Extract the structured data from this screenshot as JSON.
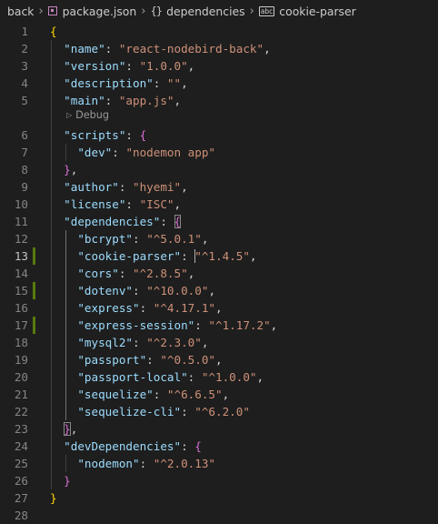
{
  "breadcrumb": {
    "folder": "back",
    "file": "package.json",
    "section": "dependencies",
    "symbol": "cookie-parser",
    "separator": "›"
  },
  "codelens": "Debug",
  "active_line": 13,
  "lines": [
    {
      "n": "1",
      "tokens": [
        {
          "t": "{",
          "c": "b1"
        }
      ]
    },
    {
      "n": "2",
      "tokens": [
        {
          "t": "  "
        },
        {
          "t": "\"name\"",
          "c": "k"
        },
        {
          "t": ": "
        },
        {
          "t": "\"react-nodebird-back\"",
          "c": "s"
        },
        {
          "t": ","
        }
      ]
    },
    {
      "n": "3",
      "tokens": [
        {
          "t": "  "
        },
        {
          "t": "\"version\"",
          "c": "k"
        },
        {
          "t": ": "
        },
        {
          "t": "\"1.0.0\"",
          "c": "s"
        },
        {
          "t": ","
        }
      ]
    },
    {
      "n": "4",
      "tokens": [
        {
          "t": "  "
        },
        {
          "t": "\"description\"",
          "c": "k"
        },
        {
          "t": ": "
        },
        {
          "t": "\"\"",
          "c": "s"
        },
        {
          "t": ","
        }
      ]
    },
    {
      "n": "5",
      "tokens": [
        {
          "t": "  "
        },
        {
          "t": "\"main\"",
          "c": "k"
        },
        {
          "t": ": "
        },
        {
          "t": "\"app.js\"",
          "c": "s"
        },
        {
          "t": ","
        }
      ]
    },
    {
      "n": "6",
      "tokens": [
        {
          "t": "  "
        },
        {
          "t": "\"scripts\"",
          "c": "k"
        },
        {
          "t": ": "
        },
        {
          "t": "{",
          "c": "b2"
        }
      ]
    },
    {
      "n": "7",
      "tokens": [
        {
          "t": "    "
        },
        {
          "t": "\"dev\"",
          "c": "k"
        },
        {
          "t": ": "
        },
        {
          "t": "\"nodemon app\"",
          "c": "s"
        }
      ]
    },
    {
      "n": "8",
      "tokens": [
        {
          "t": "  "
        },
        {
          "t": "}",
          "c": "b2"
        },
        {
          "t": ","
        }
      ]
    },
    {
      "n": "9",
      "tokens": [
        {
          "t": "  "
        },
        {
          "t": "\"author\"",
          "c": "k"
        },
        {
          "t": ": "
        },
        {
          "t": "\"hyemi\"",
          "c": "s"
        },
        {
          "t": ","
        }
      ]
    },
    {
      "n": "10",
      "tokens": [
        {
          "t": "  "
        },
        {
          "t": "\"license\"",
          "c": "k"
        },
        {
          "t": ": "
        },
        {
          "t": "\"ISC\"",
          "c": "s"
        },
        {
          "t": ","
        }
      ]
    },
    {
      "n": "11",
      "tokens": [
        {
          "t": "  "
        },
        {
          "t": "\"dependencies\"",
          "c": "k"
        },
        {
          "t": ": "
        },
        {
          "t": "{",
          "c": "b2 bm"
        }
      ]
    },
    {
      "n": "12",
      "tokens": [
        {
          "t": "    "
        },
        {
          "t": "\"bcrypt\"",
          "c": "k"
        },
        {
          "t": ": "
        },
        {
          "t": "\"^5.0.1\"",
          "c": "s"
        },
        {
          "t": ","
        }
      ]
    },
    {
      "n": "13",
      "tokens": [
        {
          "t": "    "
        },
        {
          "t": "\"cookie-parser\"",
          "c": "k"
        },
        {
          "t": ": "
        },
        {
          "t": "",
          "c": "cursor"
        },
        {
          "t": "\"^1.4.5\"",
          "c": "s"
        },
        {
          "t": ","
        }
      ]
    },
    {
      "n": "14",
      "tokens": [
        {
          "t": "    "
        },
        {
          "t": "\"cors\"",
          "c": "k"
        },
        {
          "t": ": "
        },
        {
          "t": "\"^2.8.5\"",
          "c": "s"
        },
        {
          "t": ","
        }
      ]
    },
    {
      "n": "15",
      "tokens": [
        {
          "t": "    "
        },
        {
          "t": "\"dotenv\"",
          "c": "k"
        },
        {
          "t": ": "
        },
        {
          "t": "\"^10.0.0\"",
          "c": "s"
        },
        {
          "t": ","
        }
      ]
    },
    {
      "n": "16",
      "tokens": [
        {
          "t": "    "
        },
        {
          "t": "\"express\"",
          "c": "k"
        },
        {
          "t": ": "
        },
        {
          "t": "\"^4.17.1\"",
          "c": "s"
        },
        {
          "t": ","
        }
      ]
    },
    {
      "n": "17",
      "tokens": [
        {
          "t": "    "
        },
        {
          "t": "\"express-session\"",
          "c": "k"
        },
        {
          "t": ": "
        },
        {
          "t": "\"^1.17.2\"",
          "c": "s"
        },
        {
          "t": ","
        }
      ]
    },
    {
      "n": "18",
      "tokens": [
        {
          "t": "    "
        },
        {
          "t": "\"mysql2\"",
          "c": "k"
        },
        {
          "t": ": "
        },
        {
          "t": "\"^2.3.0\"",
          "c": "s"
        },
        {
          "t": ","
        }
      ]
    },
    {
      "n": "19",
      "tokens": [
        {
          "t": "    "
        },
        {
          "t": "\"passport\"",
          "c": "k"
        },
        {
          "t": ": "
        },
        {
          "t": "\"^0.5.0\"",
          "c": "s"
        },
        {
          "t": ","
        }
      ]
    },
    {
      "n": "20",
      "tokens": [
        {
          "t": "    "
        },
        {
          "t": "\"passport-local\"",
          "c": "k"
        },
        {
          "t": ": "
        },
        {
          "t": "\"^1.0.0\"",
          "c": "s"
        },
        {
          "t": ","
        }
      ]
    },
    {
      "n": "21",
      "tokens": [
        {
          "t": "    "
        },
        {
          "t": "\"sequelize\"",
          "c": "k"
        },
        {
          "t": ": "
        },
        {
          "t": "\"^6.6.5\"",
          "c": "s"
        },
        {
          "t": ","
        }
      ]
    },
    {
      "n": "22",
      "tokens": [
        {
          "t": "    "
        },
        {
          "t": "\"sequelize-cli\"",
          "c": "k"
        },
        {
          "t": ": "
        },
        {
          "t": "\"^6.2.0\"",
          "c": "s"
        }
      ]
    },
    {
      "n": "23",
      "tokens": [
        {
          "t": "  "
        },
        {
          "t": "}",
          "c": "b2 bm"
        },
        {
          "t": ","
        }
      ]
    },
    {
      "n": "24",
      "tokens": [
        {
          "t": "  "
        },
        {
          "t": "\"devDependencies\"",
          "c": "k"
        },
        {
          "t": ": "
        },
        {
          "t": "{",
          "c": "b2"
        }
      ]
    },
    {
      "n": "25",
      "tokens": [
        {
          "t": "    "
        },
        {
          "t": "\"nodemon\"",
          "c": "k"
        },
        {
          "t": ": "
        },
        {
          "t": "\"^2.0.13\"",
          "c": "s"
        }
      ]
    },
    {
      "n": "26",
      "tokens": [
        {
          "t": "  "
        },
        {
          "t": "}",
          "c": "b2"
        }
      ]
    },
    {
      "n": "27",
      "tokens": [
        {
          "t": "}",
          "c": "b1"
        }
      ]
    },
    {
      "n": "28",
      "tokens": []
    }
  ]
}
